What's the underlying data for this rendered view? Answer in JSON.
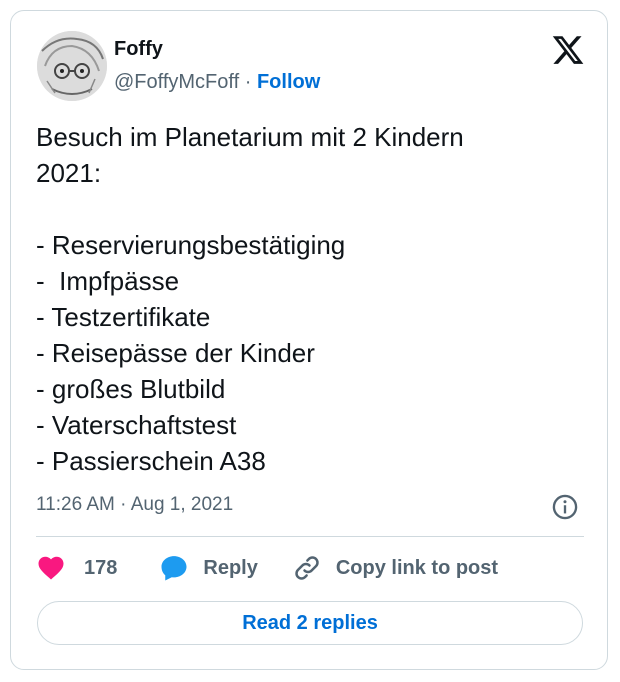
{
  "author": {
    "display_name": "Foffy",
    "handle": "@FoffyMcFoff",
    "separator": "·",
    "follow_label": "Follow",
    "avatar_icon": "avatar-sketch-icon"
  },
  "tweet": {
    "text": "Besuch im Planetarium mit 2 Kindern\n2021:\n\n- Reservierungsbestätiging\n-  Impfpässe\n- Testzertifikate\n- Reisepässe der Kinder\n- großes Blutbild\n- Vaterschaftstest\n- Passierschein A38",
    "timestamp": "11:26 AM · Aug 1, 2021"
  },
  "actions": {
    "like_count": "178",
    "reply_label": "Reply",
    "copy_link_label": "Copy link to post"
  },
  "read_replies_label": "Read 2 replies",
  "colors": {
    "like": "#f91880",
    "reply": "#1d9bf0",
    "follow": "#006fd6",
    "text_secondary": "#536471",
    "border": "#cfd9de"
  }
}
